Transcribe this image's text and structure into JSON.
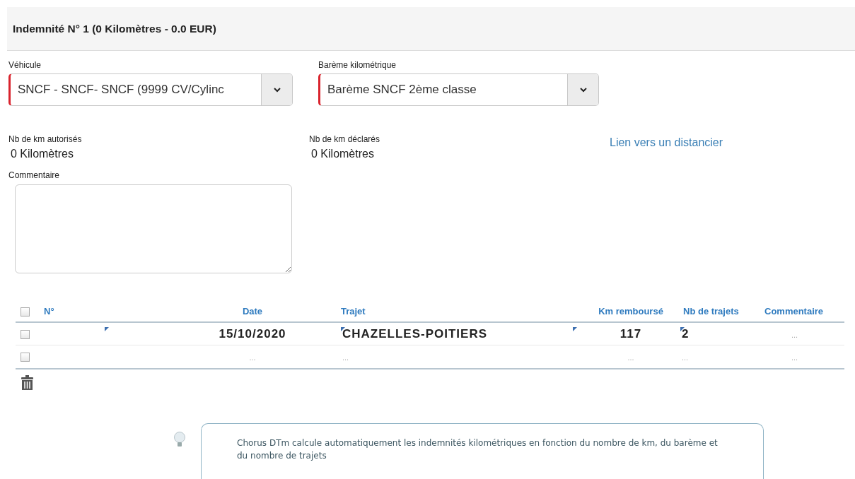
{
  "header": {
    "title": "Indemnité N° 1 (0 Kilomètres - 0.0 EUR)"
  },
  "selects": [
    {
      "label": "Véhicule",
      "value": "SNCF - SNCF- SNCF (9999 CV/Cylinc",
      "required": true
    },
    {
      "label": "Barème kilométrique",
      "value": "Barème SNCF 2ème classe",
      "required": true
    }
  ],
  "stats": [
    {
      "label": "Nb de km autorisés",
      "value": "0 Kilomètres"
    },
    {
      "label": "Nb de km déclarés",
      "value": "0 Kilomètres"
    }
  ],
  "link": "Lien vers un distancier",
  "comment": {
    "label": "Commentaire"
  },
  "table": {
    "all_checked": false,
    "columns": [
      "N°",
      "Date",
      "Trajet",
      "Km remboursé",
      "Nb de trajets",
      "Commentaire"
    ],
    "rows": [
      {
        "checked": false,
        "cells": [
          {
            "marked": true
          },
          {
            "text": "15/10/2020",
            "muted": false
          },
          {
            "text": "CHAZELLES-POITIERS",
            "marked": true,
            "muted": false
          },
          {
            "text": "117",
            "marked": true,
            "muted": false
          },
          {
            "text": "2",
            "marked": true,
            "muted": false
          },
          {
            "text": "...",
            "muted": true
          }
        ]
      },
      {
        "checked": false,
        "cells": [
          {},
          {
            "text": "...",
            "muted": true
          },
          {
            "text": "...",
            "muted": true
          },
          {
            "text": "...",
            "muted": true
          },
          {
            "text": "...",
            "muted": true
          },
          {
            "text": "...",
            "muted": true
          }
        ]
      }
    ]
  },
  "tip": "Chorus DTm calcule automatiquement les indemnités kilométriques en fonction du nombre de km, du barème et du nombre de trajets"
}
